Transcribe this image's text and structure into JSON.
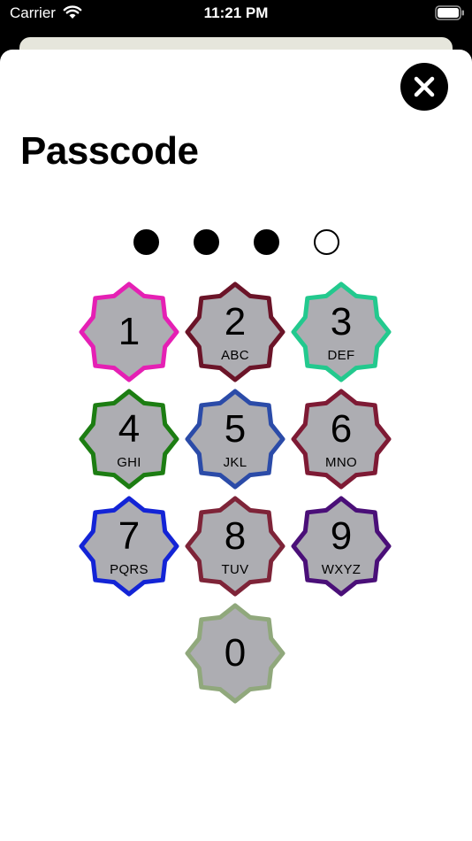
{
  "status_bar": {
    "carrier": "Carrier",
    "time": "11:21 PM"
  },
  "title": "Passcode",
  "close_icon": "close-icon",
  "passcode": {
    "length": 4,
    "entered": 3
  },
  "keypad": [
    {
      "digit": "1",
      "letters": "",
      "color": "#e520b4"
    },
    {
      "digit": "2",
      "letters": "ABC",
      "color": "#6b1428"
    },
    {
      "digit": "3",
      "letters": "DEF",
      "color": "#23c98e"
    },
    {
      "digit": "4",
      "letters": "GHI",
      "color": "#1c7d12"
    },
    {
      "digit": "5",
      "letters": "JKL",
      "color": "#2b4ba8"
    },
    {
      "digit": "6",
      "letters": "MNO",
      "color": "#7e1a34"
    },
    {
      "digit": "7",
      "letters": "PQRS",
      "color": "#1324d6"
    },
    {
      "digit": "8",
      "letters": "TUV",
      "color": "#7e2438"
    },
    {
      "digit": "9",
      "letters": "WXYZ",
      "color": "#4a0f78"
    },
    {
      "digit": "0",
      "letters": "",
      "color": "#90a87c"
    }
  ],
  "key_fill": "#adadb2"
}
